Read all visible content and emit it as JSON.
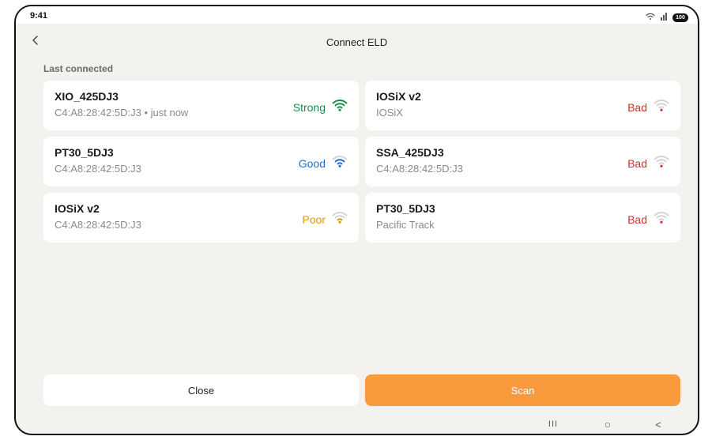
{
  "status_bar": {
    "time": "9:41",
    "battery": "100"
  },
  "header": {
    "title": "Connect ELD"
  },
  "section": {
    "label": "Last connected"
  },
  "colors": {
    "strong": "#1a8f4c",
    "good": "#1a6fd1",
    "poor": "#d69a1a",
    "bad": "#d0302f",
    "bar_inactive": "#d4d4d4",
    "scan_button": "#f99a3d"
  },
  "devices": [
    {
      "name": "XIO_425DJ3",
      "meta": "C4:A8:28:42:5D:J3 • just now",
      "signal": "Strong",
      "level": 4
    },
    {
      "name": "IOSiX v2",
      "meta": "IOSiX",
      "signal": "Bad",
      "level": 1
    },
    {
      "name": "PT30_5DJ3",
      "meta": "C4:A8:28:42:5D:J3",
      "signal": "Good",
      "level": 3
    },
    {
      "name": "SSA_425DJ3",
      "meta": "C4:A8:28:42:5D:J3",
      "signal": "Bad",
      "level": 1
    },
    {
      "name": "IOSiX v2",
      "meta": "C4:A8:28:42:5D:J3",
      "signal": "Poor",
      "level": 2
    },
    {
      "name": "PT30_5DJ3",
      "meta": "Pacific Track",
      "signal": "Bad",
      "level": 1
    }
  ],
  "buttons": {
    "close_label": "Close",
    "scan_label": "Scan"
  },
  "nav": {
    "recents_glyph": "III",
    "home_glyph": "○",
    "back_glyph": "<"
  }
}
